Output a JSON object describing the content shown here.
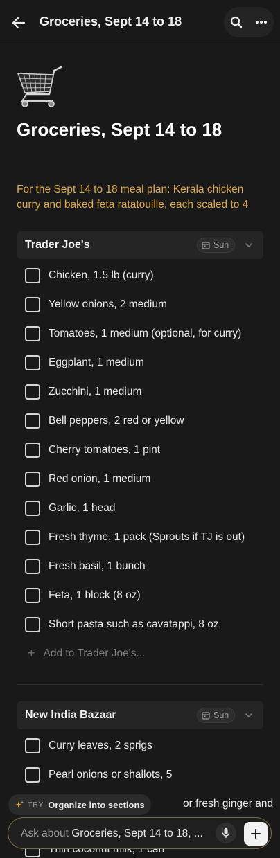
{
  "header": {
    "title": "Groceries, Sept 14 to 18",
    "back_icon": "arrow-left-icon",
    "search_icon": "search-icon",
    "more_icon": "more-horizontal-icon"
  },
  "page": {
    "icon": "shopping-cart-icon",
    "title": "Groceries, Sept 14 to 18",
    "intro": "For the Sept 14 to 18 meal plan: Kerala chicken curry and baked feta ratatouille, each scaled to 4"
  },
  "sections": [
    {
      "name": "Trader Joe's",
      "day": "Sun",
      "items": [
        "Chicken, 1.5 lb (curry)",
        "Yellow onions, 2 medium",
        "Tomatoes, 1 medium (optional, for curry)",
        "Eggplant, 1 medium",
        "Zucchini, 1 medium",
        "Bell peppers, 2 red or yellow",
        "Cherry tomatoes, 1 pint",
        "Red onion, 1 medium",
        "Garlic, 1 head",
        "Fresh thyme, 1 pack (Sprouts if TJ is out)",
        "Fresh basil, 1 bunch",
        "Feta, 1 block (8 oz)",
        "Short pasta such as cavatappi, 8 oz"
      ],
      "add_label": "Add to Trader Joe's..."
    },
    {
      "name": "New India Bazaar",
      "day": "Sun",
      "items": [
        "Curry leaves, 2 sprigs",
        "Pearl onions or shallots, 5",
        "or fresh ginger and",
        "Thin coconut milk, 1 can"
      ]
    }
  ],
  "suggestion": {
    "tag": "TRY",
    "text": "Organize into sections"
  },
  "ask_bar": {
    "prefix": "Ask about ",
    "subject": "Groceries, Sept 14 to 18, ..."
  },
  "colors": {
    "background": "#191919",
    "accent_text": "#e0a94a",
    "section_bg": "#252525"
  }
}
